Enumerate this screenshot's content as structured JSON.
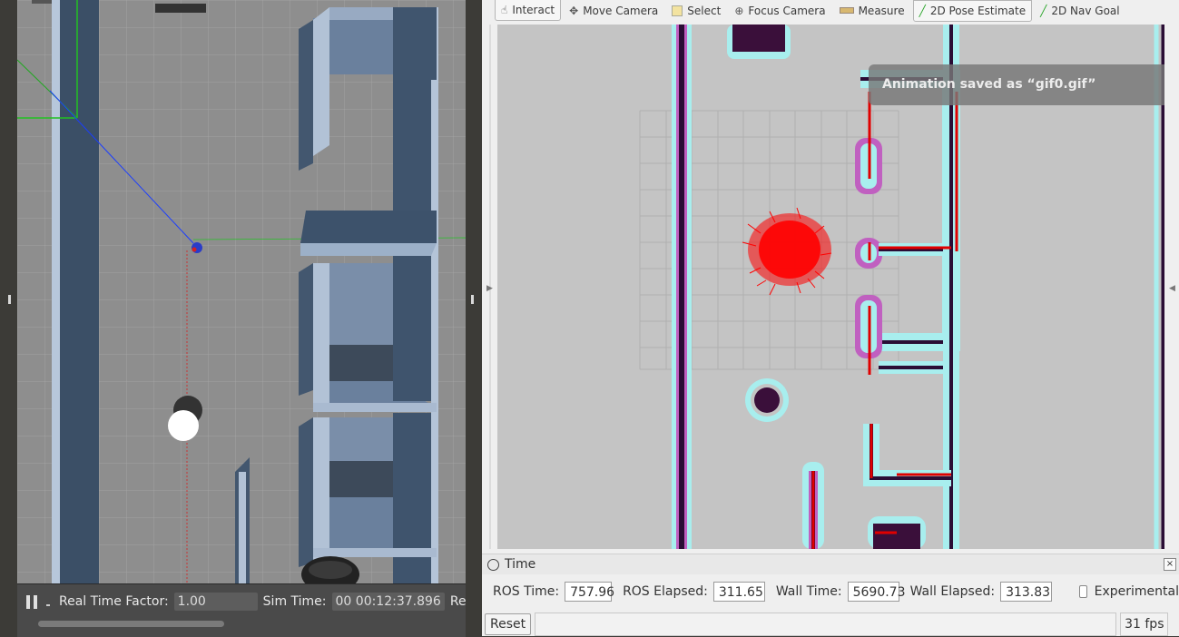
{
  "gazebo": {
    "rtf_label": "Real Time Factor:",
    "rtf_value": "1.00",
    "sim_time_label": "Sim Time:",
    "sim_time_value": "00 00:12:37.896",
    "real_time_label": "Real"
  },
  "rviz": {
    "toolbar": [
      {
        "label": "Interact",
        "icon": "hand-icon"
      },
      {
        "label": "Move Camera",
        "icon": "move-camera-icon"
      },
      {
        "label": "Select",
        "icon": "select-icon"
      },
      {
        "label": "Focus Camera",
        "icon": "focus-camera-icon"
      },
      {
        "label": "Measure",
        "icon": "ruler-icon"
      },
      {
        "label": "2D Pose Estimate",
        "icon": "pose-arrow-icon"
      },
      {
        "label": "2D Nav Goal",
        "icon": "nav-goal-arrow-icon"
      }
    ],
    "toast": "Animation saved as “gif0.gif”",
    "time_panel": {
      "title": "Time",
      "ros_time_label": "ROS Time:",
      "ros_time": "757.96",
      "ros_elapsed_label": "ROS Elapsed:",
      "ros_elapsed": "311.65",
      "wall_time_label": "Wall Time:",
      "wall_time": "5690.73",
      "wall_elapsed_label": "Wall Elapsed:",
      "wall_elapsed": "313.83",
      "experimental_label": "Experimental"
    },
    "reset_label": "Reset",
    "fps": "31 fps"
  },
  "colors": {
    "costmap_cyan": "#a8eeee",
    "inflation_magenta": "#c060c0",
    "obstacle_dark": "#3a0f3a",
    "particle_red": "#ff0000",
    "laser_red": "#e00000",
    "gazebo_floor": "#8e8e8e",
    "gazebo_wall": "#3d5069"
  }
}
